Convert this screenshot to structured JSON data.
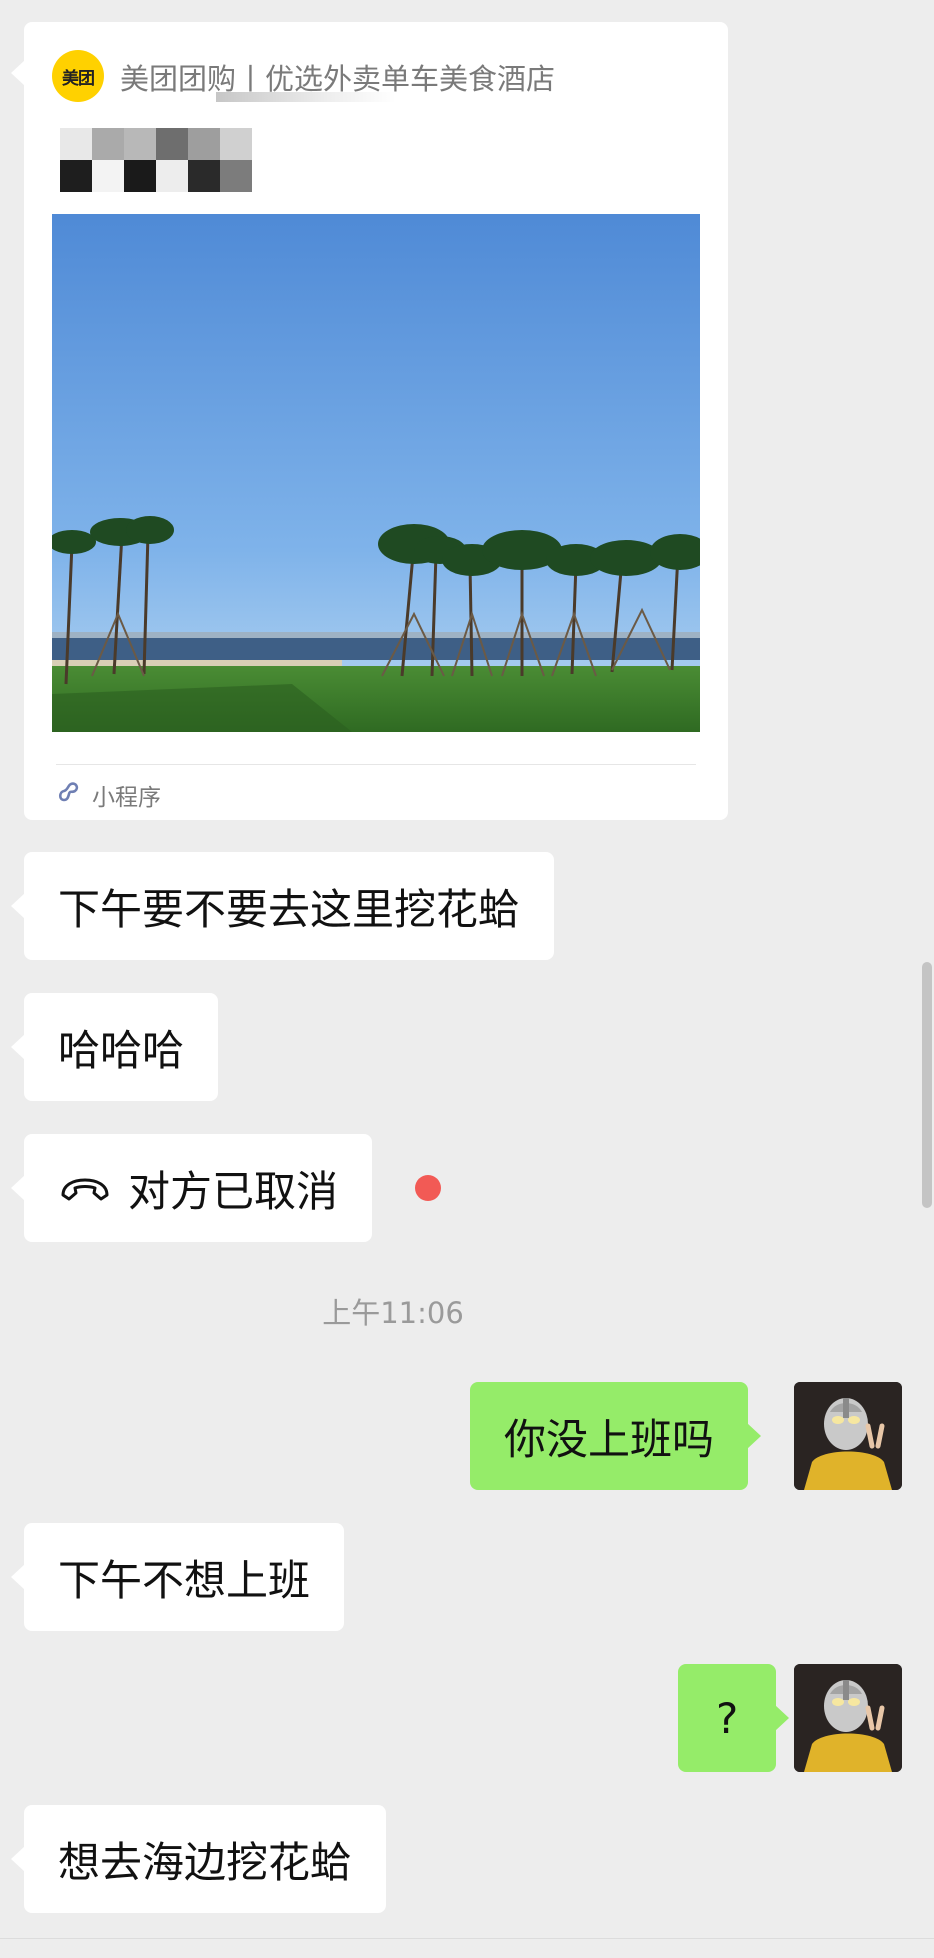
{
  "mini_program_card": {
    "logo_text": "美团",
    "app_name": "美团团购丨优选外卖单车美食酒店",
    "title_redacted": "(blurred text)",
    "footer_label": "小程序",
    "image_description": "seaside lawn with palm trees under blue sky"
  },
  "messages": [
    {
      "side": "left",
      "text": "下午要不要去这里挖花蛤"
    },
    {
      "side": "left",
      "text": "哈哈哈"
    },
    {
      "side": "left",
      "type": "call",
      "text": "对方已取消"
    },
    {
      "side": "right",
      "text": "你没上班吗"
    },
    {
      "side": "left",
      "text": "下午不想上班"
    },
    {
      "side": "right",
      "text": "?"
    },
    {
      "side": "left",
      "text": "想去海边挖花蛤"
    }
  ],
  "timestamp": "上午11:06",
  "colors": {
    "background": "#ededed",
    "incoming_bubble": "#ffffff",
    "outgoing_bubble": "#95ec69",
    "unread_dot": "#f25a55",
    "meituan_yellow": "#ffd100"
  },
  "icons": {
    "call": "phone-hangup-icon",
    "mini_program": "mini-program-link-icon",
    "unread": "unread-dot-icon"
  }
}
